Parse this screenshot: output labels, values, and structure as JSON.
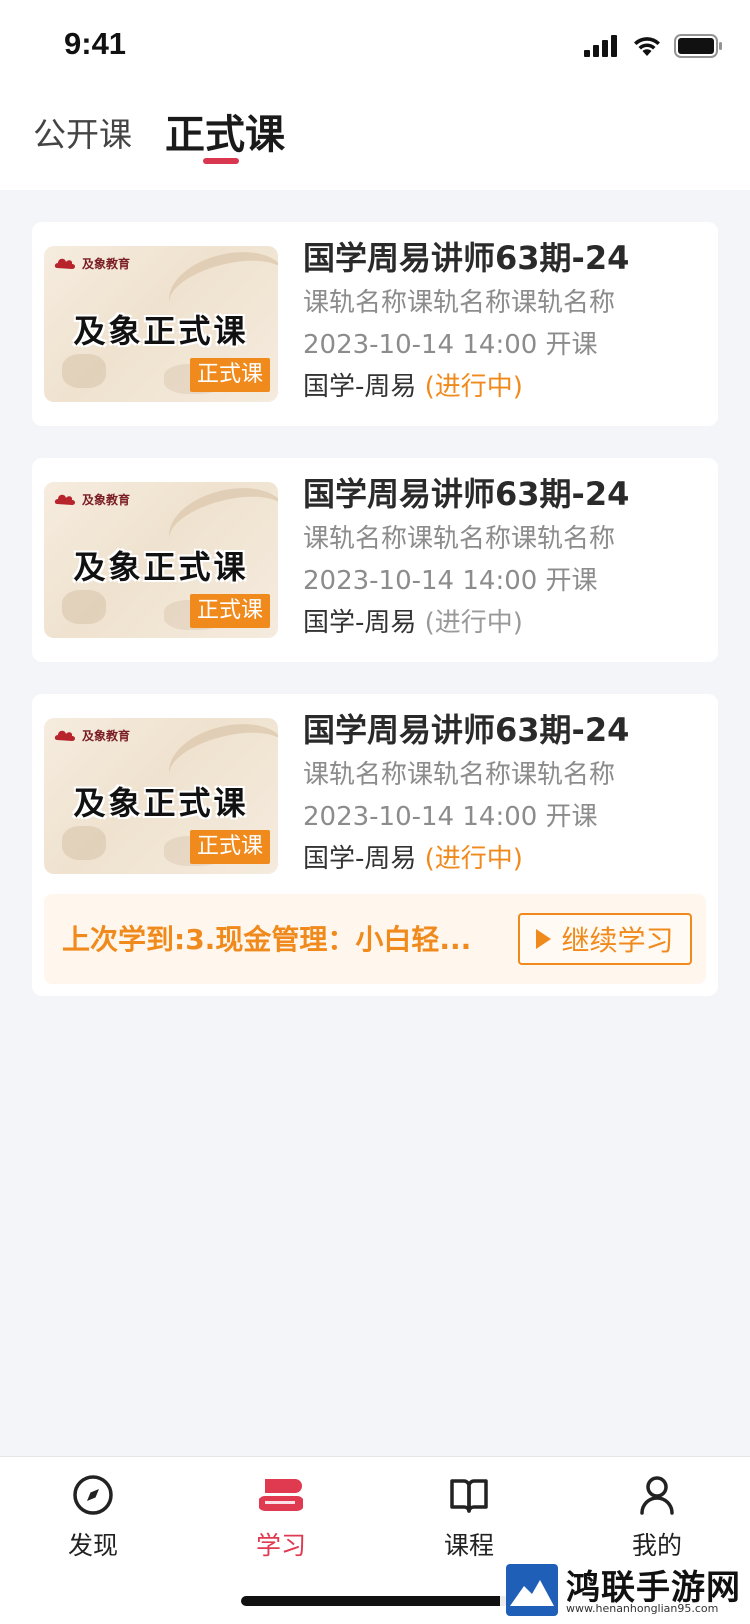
{
  "status_bar": {
    "time": "9:41"
  },
  "tabs": [
    {
      "label": "公开课",
      "active": false
    },
    {
      "label": "正式课",
      "active": true
    }
  ],
  "courses": [
    {
      "thumb_logo": "及象教育",
      "thumb_title": "及象正式课",
      "thumb_badge": "正式课",
      "title": "国学周易讲师63期-24",
      "subtitle": "课轨名称课轨名称课轨名称",
      "date": "2023-10-14 14:00 开课",
      "category": "国学-周易",
      "status": "(进行中)",
      "status_color": "#f08a1c"
    },
    {
      "thumb_logo": "及象教育",
      "thumb_title": "及象正式课",
      "thumb_badge": "正式课",
      "title": "国学周易讲师63期-24",
      "subtitle": "课轨名称课轨名称课轨名称",
      "date": "2023-10-14 14:00 开课",
      "category": "国学-周易",
      "status": "(进行中)",
      "status_color": "#999999"
    },
    {
      "thumb_logo": "及象教育",
      "thumb_title": "及象正式课",
      "thumb_badge": "正式课",
      "title": "国学周易讲师63期-24",
      "subtitle": "课轨名称课轨名称课轨名称",
      "date": "2023-10-14 14:00 开课",
      "category": "国学-周易",
      "status": "(进行中)",
      "status_color": "#f08a1c",
      "last_study": "上次学到:3.现金管理：小白轻...",
      "continue_label": "继续学习"
    }
  ],
  "bottom_nav": [
    {
      "label": "发现",
      "icon": "compass-icon",
      "active": false
    },
    {
      "label": "学习",
      "icon": "books-icon",
      "active": true
    },
    {
      "label": "课程",
      "icon": "book-icon",
      "active": false
    },
    {
      "label": "我的",
      "icon": "user-icon",
      "active": false
    }
  ],
  "watermark": {
    "text": "鸿联手游网",
    "url": "www.henanhonglian95.com"
  },
  "colors": {
    "accent": "#e03a50",
    "orange": "#f08a1c"
  }
}
